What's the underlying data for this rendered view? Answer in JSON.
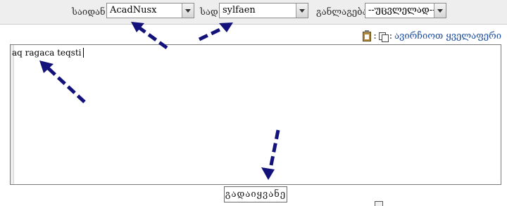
{
  "toolbar": {
    "font_label": "საიდან:",
    "font_value": "AcadNusx",
    "target_label": "სად:",
    "target_value": "sylfaen",
    "layout_label": "განლაგება?",
    "layout_value": "--უცვლელად--"
  },
  "actions": {
    "copy_link": "ავირჩიოთ ყველაფერი"
  },
  "editor": {
    "text": "aq ragaca teqsti"
  },
  "submit": {
    "label": "გადაიყვანე"
  },
  "colors": {
    "annotation_arrow": "#12127a",
    "link": "#1f4fa0"
  },
  "icons": [
    "chevron-down-icon",
    "clipboard-icon",
    "copy-icon",
    "annotation-arrow"
  ]
}
